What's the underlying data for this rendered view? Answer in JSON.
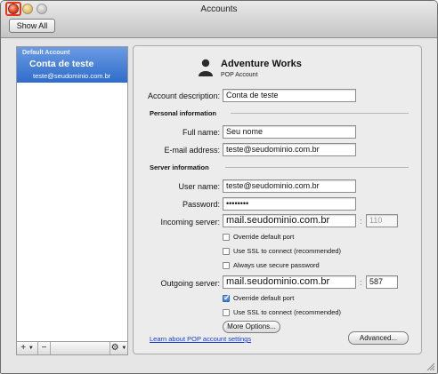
{
  "window": {
    "title": "Accounts",
    "show_all_label": "Show All"
  },
  "sidebar": {
    "section_header": "Default Account",
    "account_name": "Conta de teste",
    "account_email": "teste@seudominio.com.br",
    "add_label": "+",
    "remove_label": "−",
    "gear_label": "⚙"
  },
  "account": {
    "title": "Adventure Works",
    "type": "POP Account",
    "description_label": "Account description:",
    "description_value": "Conta de teste"
  },
  "personal": {
    "section_title": "Personal information",
    "full_name_label": "Full name:",
    "full_name_value": "Seu nome",
    "email_label": "E-mail address:",
    "email_value": "teste@seudominio.com.br"
  },
  "server": {
    "section_title": "Server information",
    "user_name_label": "User name:",
    "user_name_value": "teste@seudominio.com.br",
    "password_label": "Password:",
    "password_value": "••••••••",
    "incoming_label": "Incoming server:",
    "incoming_value": "mail.seudominio.com.br",
    "incoming_port": "110",
    "incoming_override": {
      "label": "Override default port",
      "checked": false
    },
    "incoming_ssl": {
      "label": "Use SSL to connect (recommended)",
      "checked": false
    },
    "incoming_secure_pw": {
      "label": "Always use secure password",
      "checked": false
    },
    "outgoing_label": "Outgoing server:",
    "outgoing_value": "mail.seudominio.com.br",
    "outgoing_port": "587",
    "outgoing_override": {
      "label": "Override default port",
      "checked": true
    },
    "outgoing_ssl": {
      "label": "Use SSL to connect (recommended)",
      "checked": false
    },
    "more_options_label": "More Options..."
  },
  "footer": {
    "learn_link": "Learn about POP account settings",
    "advanced_label": "Advanced..."
  },
  "colors": {
    "selection_blue": "#2f6ccb",
    "link_blue": "#1a3fc9",
    "close_red": "#e13b1c"
  }
}
